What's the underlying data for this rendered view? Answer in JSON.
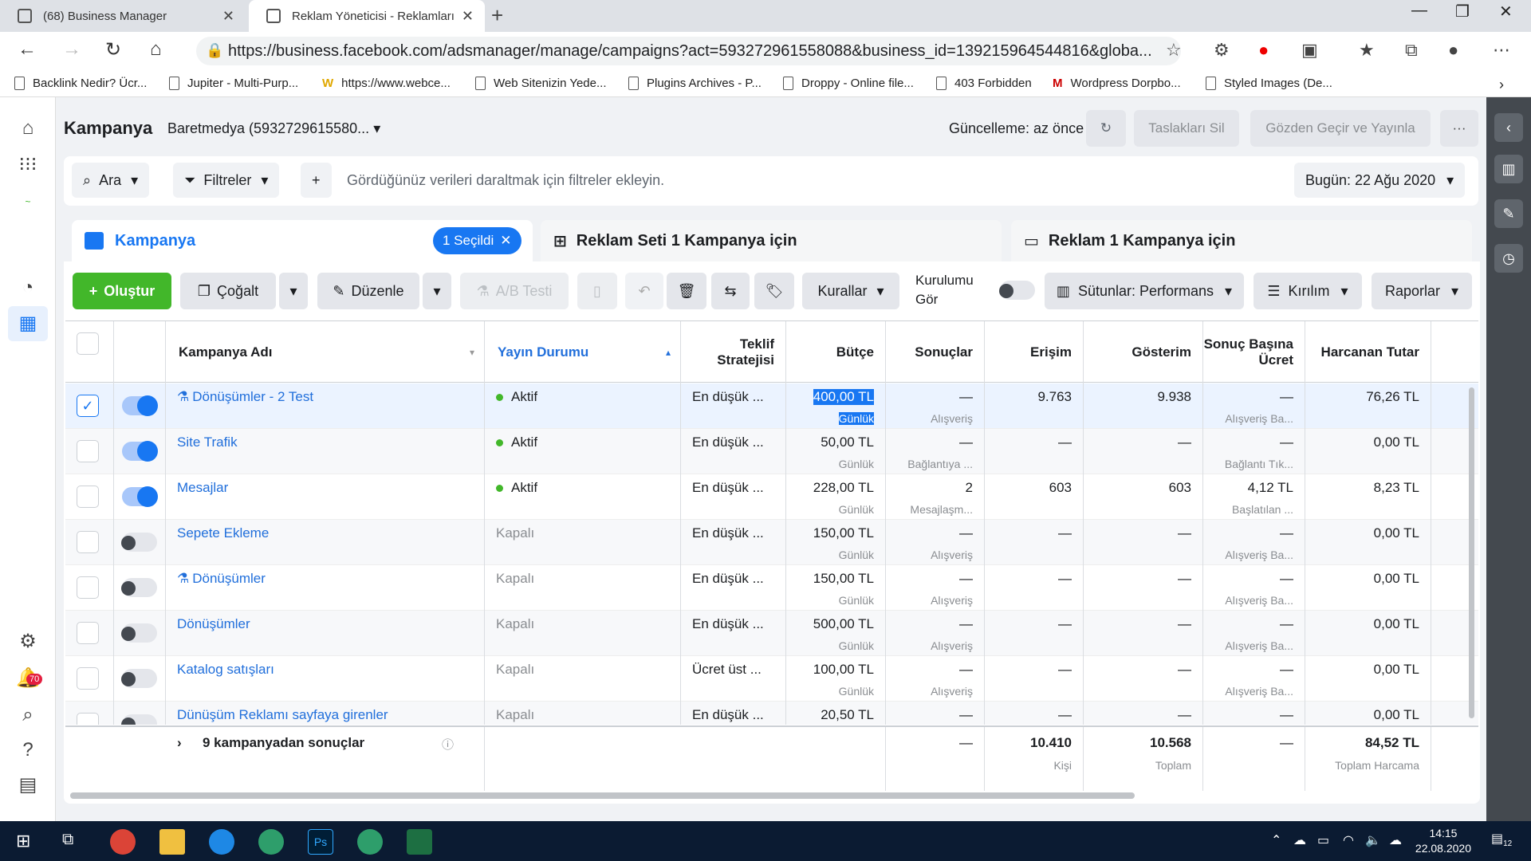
{
  "browser": {
    "tabs": [
      {
        "title": "(68) Business Manager"
      },
      {
        "title": "Reklam Yöneticisi - Reklamları Yö"
      }
    ],
    "url": "https://business.facebook.com/adsmanager/manage/campaigns?act=593272961558088&business_id=139215964544816&globa...",
    "bookmarks": [
      "Backlink Nedir? Ücr...",
      "Jupiter - Multi-Purp...",
      "https://www.webce...",
      "Web Sitenizin Yede...",
      "Plugins Archives - P...",
      "Droppy - Online file...",
      "403 Forbidden",
      "Wordpress Dorpbo...",
      "Styled Images (De..."
    ]
  },
  "header": {
    "title": "Kampanya",
    "account": "Baretmedya (5932729615580...",
    "update": "Güncelleme: az önce",
    "discard": "Taslakları Sil",
    "publish": "Gözden Geçir ve Yayınla",
    "more": "···"
  },
  "filterbar": {
    "search": "Ara",
    "filters": "Filtreler",
    "plus": "+",
    "hint": "Gördüğünüz verileri daraltmak için filtreler ekleyin.",
    "date": "Bugün: 22 Ağu 2020"
  },
  "levels": {
    "campaign": "Kampanya",
    "selected": "1 Seçildi",
    "adset": "Reklam Seti 1 Kampanya için",
    "ad": "Reklam 1 Kampanya için"
  },
  "toolbar": {
    "create": "Oluştur",
    "duplicate": "Çoğalt",
    "edit": "Düzenle",
    "abtest": "A/B Testi",
    "rules": "Kurallar",
    "setup_view": "Kurulumu Gör",
    "columns": "Sütunlar: Performans",
    "breakdown": "Kırılım",
    "reports": "Raporlar"
  },
  "columns": {
    "name": "Kampanya Adı",
    "delivery": "Yayın Durumu",
    "bid": "Teklif Stratejisi",
    "budget": "Bütçe",
    "results": "Sonuçlar",
    "reach": "Erişim",
    "impressions": "Gösterim",
    "cpr": "Sonuç Başına Ücret",
    "spent": "Harcanan Tutar"
  },
  "rows": [
    {
      "name": "Dönüşümler - 2 Test",
      "flask": "⚗",
      "delivery": "Aktif",
      "active": true,
      "on": true,
      "checked": true,
      "bid": "En düşük ...",
      "budget": "400,00 TL",
      "budget_sub": "Günlük",
      "results": "—",
      "results_sub": "Alışveriş",
      "reach": "9.763",
      "impr": "9.938",
      "cpr": "—",
      "cpr_sub": "Alışveriş Ba...",
      "spent": "76,26 TL"
    },
    {
      "name": "Site Trafik",
      "flask": "",
      "delivery": "Aktif",
      "active": true,
      "on": true,
      "checked": false,
      "bid": "En düşük ...",
      "budget": "50,00 TL",
      "budget_sub": "Günlük",
      "results": "—",
      "results_sub": "Bağlantıya ...",
      "reach": "—",
      "impr": "—",
      "cpr": "—",
      "cpr_sub": "Bağlantı Tık...",
      "spent": "0,00 TL"
    },
    {
      "name": "Mesajlar",
      "flask": "",
      "delivery": "Aktif",
      "active": true,
      "on": true,
      "checked": false,
      "bid": "En düşük ...",
      "budget": "228,00 TL",
      "budget_sub": "Günlük",
      "results": "2",
      "results_sub": "Mesajlaşm...",
      "reach": "603",
      "impr": "603",
      "cpr": "4,12 TL",
      "cpr_sub": "Başlatılan ...",
      "spent": "8,23 TL"
    },
    {
      "name": "Sepete Ekleme",
      "flask": "",
      "delivery": "Kapalı",
      "active": false,
      "on": false,
      "checked": false,
      "bid": "En düşük ...",
      "budget": "150,00 TL",
      "budget_sub": "Günlük",
      "results": "—",
      "results_sub": "Alışveriş",
      "reach": "—",
      "impr": "—",
      "cpr": "—",
      "cpr_sub": "Alışveriş Ba...",
      "spent": "0,00 TL"
    },
    {
      "name": "Dönüşümler",
      "flask": "⚗",
      "delivery": "Kapalı",
      "active": false,
      "on": false,
      "checked": false,
      "bid": "En düşük ...",
      "budget": "150,00 TL",
      "budget_sub": "Günlük",
      "results": "—",
      "results_sub": "Alışveriş",
      "reach": "—",
      "impr": "—",
      "cpr": "—",
      "cpr_sub": "Alışveriş Ba...",
      "spent": "0,00 TL"
    },
    {
      "name": "Dönüşümler",
      "flask": "",
      "delivery": "Kapalı",
      "active": false,
      "on": false,
      "checked": false,
      "bid": "En düşük ...",
      "budget": "500,00 TL",
      "budget_sub": "Günlük",
      "results": "—",
      "results_sub": "Alışveriş",
      "reach": "—",
      "impr": "—",
      "cpr": "—",
      "cpr_sub": "Alışveriş Ba...",
      "spent": "0,00 TL"
    },
    {
      "name": "Katalog satışları",
      "flask": "",
      "delivery": "Kapalı",
      "active": false,
      "on": false,
      "checked": false,
      "bid": "Ücret üst ...",
      "budget": "100,00 TL",
      "budget_sub": "Günlük",
      "results": "—",
      "results_sub": "Alışveriş",
      "reach": "—",
      "impr": "—",
      "cpr": "—",
      "cpr_sub": "Alışveriş Ba...",
      "spent": "0,00 TL"
    },
    {
      "name": "Dünüşüm Reklamı sayfaya girenler",
      "flask": "",
      "delivery": "Kapalı",
      "active": false,
      "on": false,
      "checked": false,
      "bid": "En düşük ...",
      "budget": "20,50 TL",
      "budget_sub": "",
      "results": "—",
      "results_sub": "",
      "reach": "—",
      "impr": "—",
      "cpr": "—",
      "cpr_sub": "",
      "spent": "0,00 TL"
    }
  ],
  "totals": {
    "label": "9 kampanyadan sonuçlar",
    "results": "—",
    "reach": "10.410",
    "reach_sub": "Kişi",
    "impr": "10.568",
    "impr_sub": "Toplam",
    "cpr": "—",
    "spent": "84,52 TL",
    "spent_sub": "Toplam Harcama"
  },
  "notifications": "70",
  "clock": {
    "time": "14:15",
    "date": "22.08.2020"
  },
  "tray_badge": "12",
  "colors": {
    "accent": "#1877f2",
    "create": "#42b72a",
    "active_dot": "#42b72a"
  }
}
